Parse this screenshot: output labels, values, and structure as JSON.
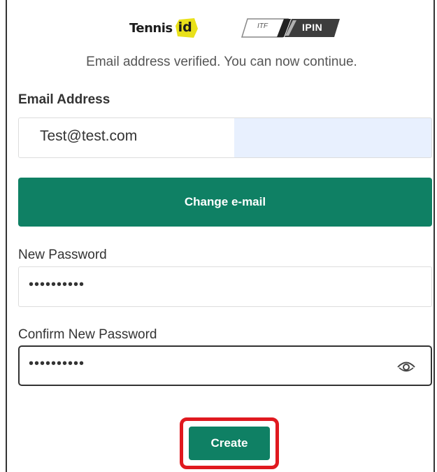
{
  "branding": {
    "tennis_word": "Tennis",
    "id_mark": "id",
    "itf_mark": "ITF",
    "ipin_mark": "IPIN",
    "accent_yellow": "#e9e11a"
  },
  "status_message": "Email address verified. You can now continue.",
  "email": {
    "label": "Email Address",
    "value": "Test@test.com"
  },
  "change_email_label": "Change e-mail",
  "new_password": {
    "label": "New Password",
    "masked_value": "••••••••••"
  },
  "confirm_password": {
    "label": "Confirm New Password",
    "masked_value": "••••••••••",
    "toggle_icon": "eye-icon"
  },
  "create_label": "Create",
  "colors": {
    "primary_button": "#0f8064",
    "highlight_box": "#e0191f",
    "autofill_bg": "#e8f0fe"
  }
}
